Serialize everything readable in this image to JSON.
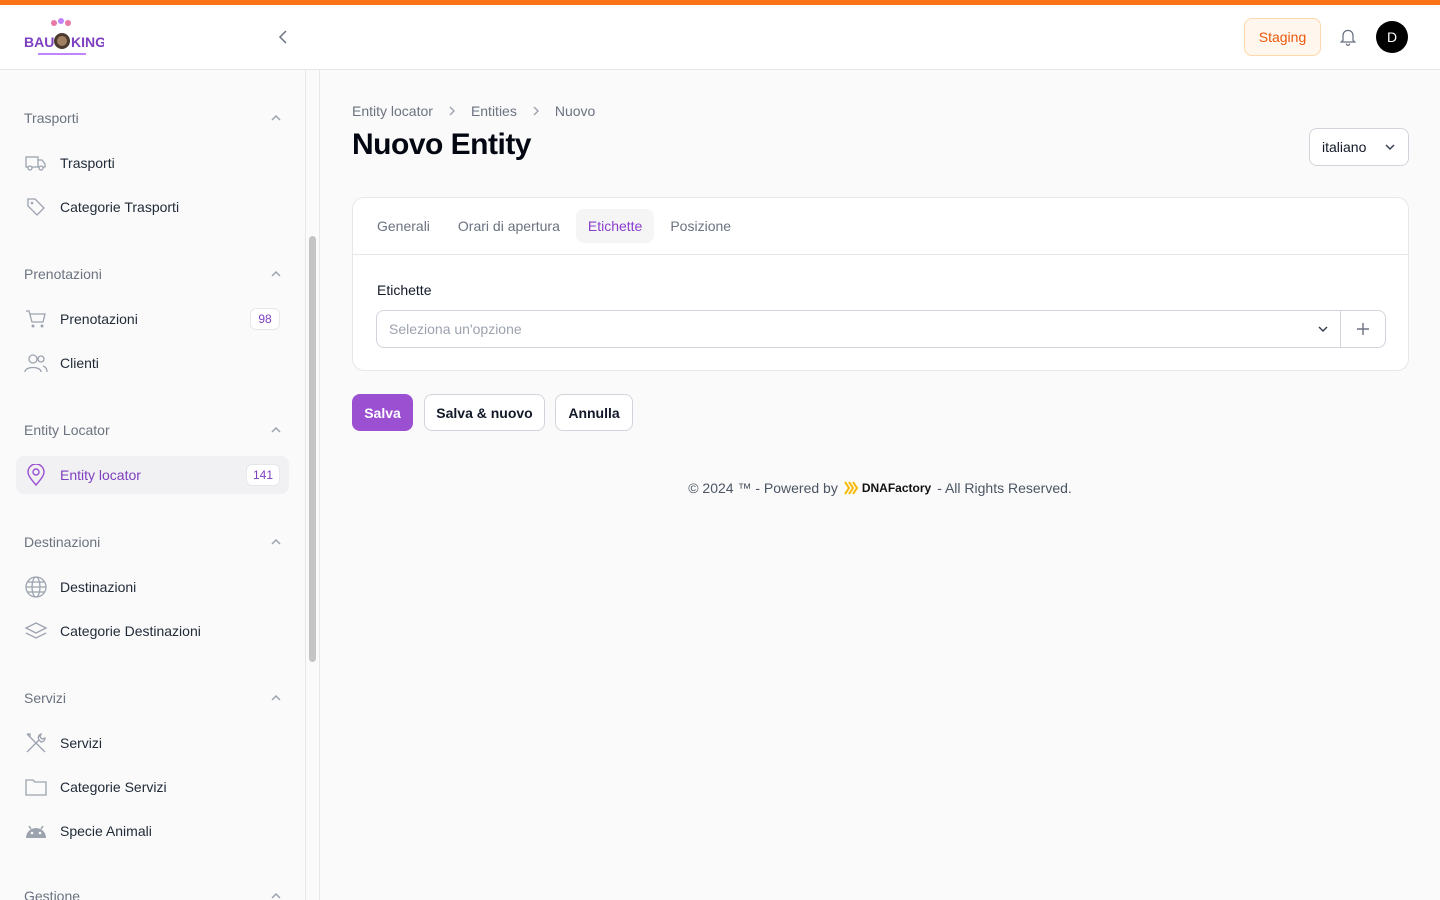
{
  "header": {
    "logo_text": "BAUKING",
    "staging_label": "Staging",
    "avatar_initial": "D"
  },
  "sidebar": {
    "groups": [
      {
        "title": "Trasporti",
        "items": [
          {
            "label": "Trasporti",
            "icon": "truck-icon"
          },
          {
            "label": "Categorie Trasporti",
            "icon": "tag-icon"
          }
        ]
      },
      {
        "title": "Prenotazioni",
        "items": [
          {
            "label": "Prenotazioni",
            "icon": "cart-icon",
            "badge": "98"
          },
          {
            "label": "Clienti",
            "icon": "users-icon"
          }
        ]
      },
      {
        "title": "Entity Locator",
        "items": [
          {
            "label": "Entity locator",
            "icon": "map-pin-icon",
            "badge": "141",
            "active": true
          }
        ]
      },
      {
        "title": "Destinazioni",
        "items": [
          {
            "label": "Destinazioni",
            "icon": "globe-icon"
          },
          {
            "label": "Categorie Destinazioni",
            "icon": "layers-icon"
          }
        ]
      },
      {
        "title": "Servizi",
        "items": [
          {
            "label": "Servizi",
            "icon": "tools-icon"
          },
          {
            "label": "Categorie Servizi",
            "icon": "folder-icon"
          },
          {
            "label": "Specie Animali",
            "icon": "android-icon"
          }
        ]
      },
      {
        "title": "Gestione",
        "items": []
      }
    ]
  },
  "breadcrumb": [
    "Entity locator",
    "Entities",
    "Nuovo"
  ],
  "page": {
    "title": "Nuovo Entity",
    "language": "italiano"
  },
  "tabs": [
    {
      "label": "Generali",
      "active": false
    },
    {
      "label": "Orari di apertura",
      "active": false
    },
    {
      "label": "Etichette",
      "active": true
    },
    {
      "label": "Posizione",
      "active": false
    }
  ],
  "form": {
    "field_label": "Etichette",
    "select_placeholder": "Seleziona un'opzione"
  },
  "actions": {
    "save": "Salva",
    "save_new": "Salva & nuovo",
    "cancel": "Annulla"
  },
  "footer": {
    "prefix": "© 2024 ™ - Powered by",
    "brand": "DNAFactory",
    "suffix": "- All Rights Reserved."
  },
  "colors": {
    "accent": "#f97316",
    "primary": "#9b4fd1",
    "active_text": "#7e3fc0"
  }
}
